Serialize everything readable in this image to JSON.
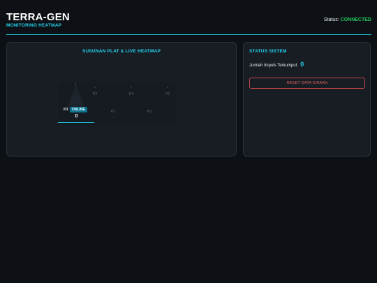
{
  "header": {
    "title": "TERRA-GEN",
    "subtitle": "MONITORING HEATMAP",
    "status_label": "Status:",
    "status_value": "CONNECTED"
  },
  "heatmap_panel": {
    "title": "SUSUNAN PLAT & LIVE HEATMAP",
    "active_plate": {
      "label": "P1",
      "badge": "ONLINE",
      "value": "0"
    },
    "plates": [
      {
        "label": "P2",
        "value": "-"
      },
      {
        "label": "P4",
        "value": "-"
      },
      {
        "label": "P6",
        "value": "-"
      },
      {
        "label": "P3",
        "value": "-"
      },
      {
        "label": "P5",
        "value": "-"
      }
    ]
  },
  "status_panel": {
    "title": "STATUS SISTEM",
    "impulse_label": "Jumlah Impuls Terkumpul:",
    "impulse_value": "0",
    "reset_label": "RESET DATA KIRAAN"
  },
  "colors": {
    "accent": "#22d3ee",
    "connected": "#22c55e",
    "danger": "#c24646",
    "background": "#0d1014",
    "panel": "#181d24"
  }
}
